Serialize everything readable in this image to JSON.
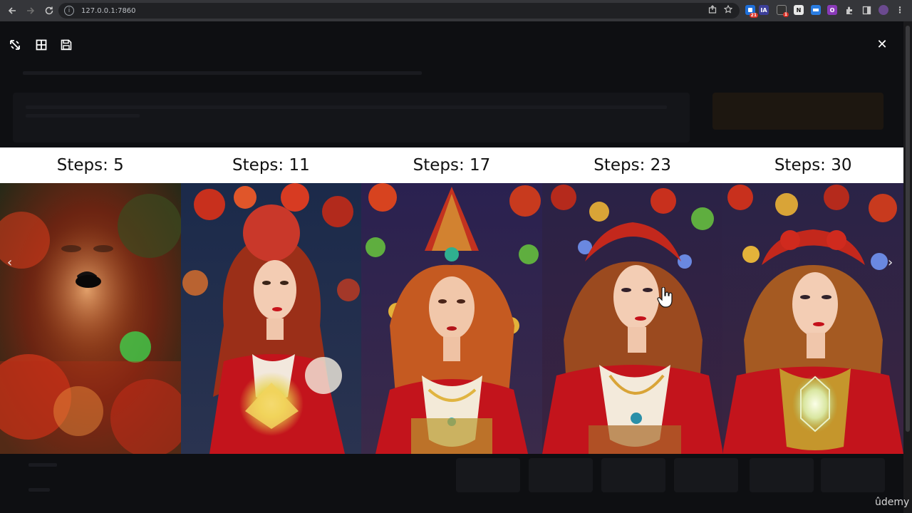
{
  "browser": {
    "url": "127.0.0.1:7860",
    "icons": [
      "back-icon",
      "forward-icon",
      "reload-icon",
      "site-info-icon",
      "share-icon",
      "bookmark-star-icon",
      "extensions-icon",
      "sidepanel-icon",
      "profile-avatar-icon"
    ],
    "extensions": [
      {
        "name": "ext-1",
        "color": "#d93025",
        "text": "",
        "badge": "21"
      },
      {
        "name": "ext-ia",
        "color": "#3c3f99",
        "text": "IA",
        "badge": ""
      },
      {
        "name": "ext-3",
        "color": "#333333",
        "text": "",
        "badge": "1"
      },
      {
        "name": "ext-n",
        "color": "#e8e8e8",
        "text": "N",
        "badge": ""
      },
      {
        "name": "ext-5",
        "color": "#2a7de1",
        "text": "",
        "badge": ""
      },
      {
        "name": "ext-o",
        "color": "#8a3ab9",
        "text": "O",
        "badge": ""
      }
    ]
  },
  "lightbox": {
    "tools": [
      "fullscreen-toggle-icon",
      "grid-icon",
      "save-icon"
    ],
    "close_label": "✕",
    "prev_label": "‹",
    "next_label": "›"
  },
  "grid": {
    "labels": [
      "Steps: 5",
      "Steps: 11",
      "Steps: 17",
      "Steps: 23",
      "Steps: 30"
    ]
  },
  "watermark": "ûdemy",
  "colors": {
    "accent": "#ff7c00",
    "robe_red": "#c3141c",
    "hair": "#a8431c",
    "gold": "#d9a437"
  }
}
